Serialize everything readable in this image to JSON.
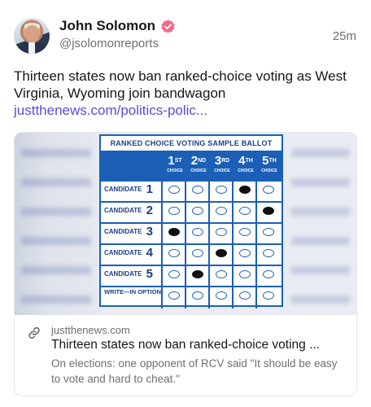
{
  "post": {
    "author_name": "John Solomon",
    "author_handle": "@jsolomonreports",
    "timestamp": "25m",
    "text": "Thirteen states now ban ranked-choice voting as West Virginia, Wyoming join bandwagon",
    "link_text": "justthenews.com/politics-polic...",
    "verified_color": "#f06b8a",
    "accent_color": "#5a4cdb"
  },
  "card": {
    "domain": "justthenews.com",
    "title": "Thirteen states now ban ranked-choice voting ...",
    "description": "On elections: one opponent of RCV said \"It should be easy to vote and hard to cheat.\"",
    "icon": "link-icon",
    "image": {
      "ballot_title": "RANKED CHOICE VOTING SAMPLE BALLOT",
      "choices": [
        {
          "num": "1",
          "sup": "ST",
          "label": "CHOICE"
        },
        {
          "num": "2",
          "sup": "ND",
          "label": "CHOICE"
        },
        {
          "num": "3",
          "sup": "RD",
          "label": "CHOICE"
        },
        {
          "num": "4",
          "sup": "TH",
          "label": "CHOICE"
        },
        {
          "num": "5",
          "sup": "TH",
          "label": "CHOICE"
        }
      ],
      "rows": [
        {
          "label": "CANDIDATE",
          "num": "1",
          "filled_choice": 4
        },
        {
          "label": "CANDIDATE",
          "num": "2",
          "filled_choice": 5
        },
        {
          "label": "CANDIDATE",
          "num": "3",
          "filled_choice": 1
        },
        {
          "label": "CANDIDATE",
          "num": "4",
          "filled_choice": 3
        },
        {
          "label": "CANDIDATE",
          "num": "5",
          "filled_choice": 2
        },
        {
          "label": "WRITE—IN OPTION",
          "num": "",
          "filled_choice": 0
        }
      ]
    }
  }
}
